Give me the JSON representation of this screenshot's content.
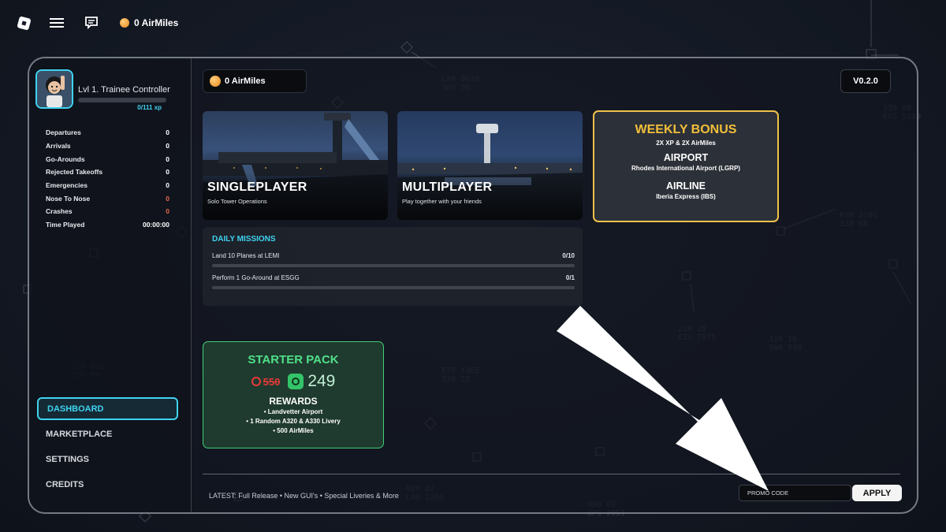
{
  "topbar": {
    "airmiles": "0 AirMiles",
    "icons": [
      "roblox-logo-icon",
      "hamburger-menu-icon",
      "chat-icon",
      "coin-icon"
    ]
  },
  "profile": {
    "level": "Lvl 1. Trainee Controller",
    "xp": "0/111 xp",
    "xp_progress": 0
  },
  "stats": [
    {
      "label": "Departures",
      "value": "0",
      "color": "#ffffff"
    },
    {
      "label": "Arrivals",
      "value": "0",
      "color": "#ffffff"
    },
    {
      "label": "Go-Arounds",
      "value": "0",
      "color": "#ffffff"
    },
    {
      "label": "Rejected Takeoffs",
      "value": "0",
      "color": "#ffffff"
    },
    {
      "label": "Emergencies",
      "value": "0",
      "color": "#ffffff"
    },
    {
      "label": "Nose To Nose",
      "value": "0",
      "color": "#e8694e"
    },
    {
      "label": "Crashes",
      "value": "0",
      "color": "#e8694e"
    },
    {
      "label": "Time Played",
      "value": "00:00:00",
      "color": "#ffffff"
    }
  ],
  "nav": {
    "dashboard": "DASHBOARD",
    "marketplace": "MARKETPLACE",
    "settings": "SETTINGS",
    "credits": "CREDITS",
    "active": "DASHBOARD"
  },
  "header": {
    "airmiles": "0 AirMiles",
    "version": "V0.2.0"
  },
  "modes": {
    "singleplayer": {
      "title": "SINGLEPLAYER",
      "subtitle": "Solo Tower Operations"
    },
    "multiplayer": {
      "title": "MULTIPLAYER",
      "subtitle": "Play together with your friends"
    }
  },
  "weekly_bonus": {
    "title": "WEEKLY BONUS",
    "bonus": "2X XP & 2X AirMiles",
    "airport_heading": "AIRPORT",
    "airport": "Rhodes International Airport (LGRP)",
    "airline_heading": "AIRLINE",
    "airline": "Iberia Express (IBS)",
    "accent": "#f2bf3a"
  },
  "daily_missions": {
    "title": "DAILY MISSIONS",
    "items": [
      {
        "label": "Land 10 Planes at LEMI",
        "count": "0/10",
        "progress": 0
      },
      {
        "label": "Perform 1 Go-Around at ESGG",
        "count": "0/1",
        "progress": 0
      }
    ]
  },
  "starter_pack": {
    "title": "STARTER PACK",
    "old_price": "550",
    "new_price": "249",
    "rewards_heading": "REWARDS",
    "rewards": [
      "• Landvetter Airport",
      "• 1 Random A320 & A330 Livery",
      "• 500 AirMiles"
    ],
    "accent": "#4fe08a"
  },
  "footer": {
    "latest": "LATEST: Full Release • New GUI's • Special Liveries & More",
    "promo_placeholder": "PROMO CODE",
    "apply_label": "APPLY"
  },
  "colors": {
    "cyan_accent": "#3fd3f0",
    "gold_accent": "#f0c24a",
    "green_accent": "#41d07a"
  }
}
